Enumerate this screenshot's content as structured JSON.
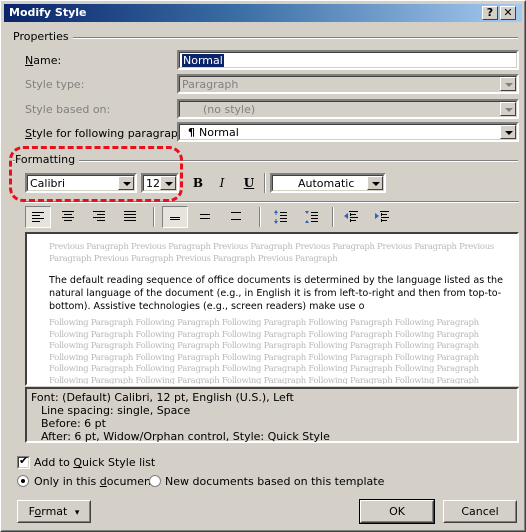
{
  "window": {
    "title": "Modify Style",
    "help_label": "?",
    "close_label": "✕"
  },
  "properties": {
    "group_label": "Properties",
    "name_label_prefix": "",
    "name_label_ul": "N",
    "name_label_rest": "ame:",
    "name_value": "Normal",
    "style_type_label": "Style type:",
    "style_type_value": "Paragraph",
    "based_on_label": "Style based on:",
    "based_on_value": "(no style)",
    "following_label_ul": "S",
    "following_label_rest": "tyle for following paragraph:",
    "following_mark": "¶",
    "following_value": "Normal"
  },
  "formatting": {
    "group_label": "Formatting",
    "font_value": "Calibri",
    "size_value": "12",
    "bold_label": "B",
    "italic_label": "I",
    "underline_label": "U",
    "color_value": "Automatic",
    "highlight_color": "#e8101a",
    "toolbar_icons": [
      "align-left-icon",
      "align-center-icon",
      "align-right-icon",
      "justify-icon",
      "single-spacing-icon",
      "one-half-spacing-icon",
      "double-spacing-icon",
      "space-before-increase-icon",
      "space-before-decrease-icon",
      "decrease-indent-icon",
      "increase-indent-icon"
    ]
  },
  "preview": {
    "previous_lines": [
      "Previous Paragraph Previous Paragraph Previous Paragraph Previous Paragraph Previous Paragraph Previous",
      "Paragraph Previous Paragraph Previous Paragraph Previous Paragraph"
    ],
    "main_text": "The default reading sequence of office documents is determined by the language listed as the natural language of the document (e.g., in English it is from left-to-right and then from top-to-bottom). Assistive technologies (e.g., screen readers) make use o",
    "following_lines": [
      "Following Paragraph Following Paragraph Following Paragraph Following Paragraph Following Paragraph",
      "Following Paragraph Following Paragraph Following Paragraph Following Paragraph Following Paragraph",
      "Following Paragraph Following Paragraph Following Paragraph Following Paragraph Following Paragraph",
      "Following Paragraph Following Paragraph Following Paragraph Following Paragraph Following Paragraph",
      "Following Paragraph Following Paragraph Following Paragraph Following Paragraph Following Paragraph",
      "Following Paragraph Following Paragraph Following Paragraph Following Paragraph Following Paragraph"
    ]
  },
  "description": {
    "line1": "Font: (Default) Calibri, 12 pt, English (U.S.), Left",
    "line2": "Line spacing:  single, Space",
    "line3": "Before:  6 pt",
    "line4": "After:  6 pt, Widow/Orphan control, Style: Quick Style"
  },
  "options": {
    "quick_style_pre": "Add to ",
    "quick_style_ul": "Q",
    "quick_style_rest": "uick Style list",
    "quick_style_checked": true,
    "only_doc_pre": "Only in this ",
    "only_doc_ul": "d",
    "only_doc_rest": "ocument",
    "only_doc_selected": true,
    "new_docs_label": "New documents based on this template",
    "new_docs_selected": false
  },
  "buttons": {
    "format_pre": "F",
    "format_ul": "o",
    "format_rest": "rmat",
    "format_arrow": "▾",
    "ok_label": "OK",
    "cancel_label": "Cancel"
  }
}
